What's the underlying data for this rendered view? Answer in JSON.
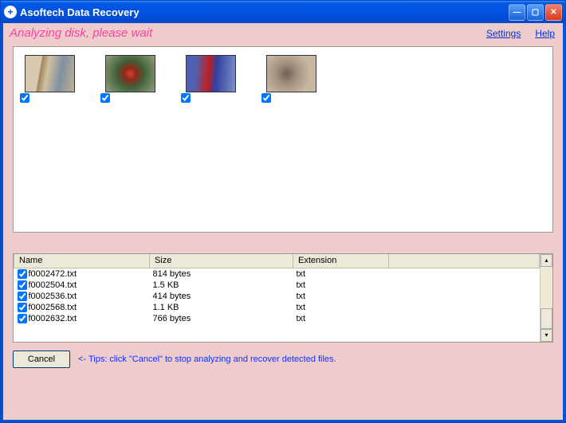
{
  "title": "Asoftech Data Recovery",
  "status": "Analyzing disk, please wait",
  "links": {
    "settings": "Settings",
    "help": "Help"
  },
  "thumbs": [
    {
      "checked": true
    },
    {
      "checked": true
    },
    {
      "checked": true
    },
    {
      "checked": true
    }
  ],
  "columns": {
    "name": "Name",
    "size": "Size",
    "ext": "Extension"
  },
  "files": [
    {
      "checked": true,
      "name": "f0002472.txt",
      "size": "814 bytes",
      "ext": "txt"
    },
    {
      "checked": true,
      "name": "f0002504.txt",
      "size": "1.5 KB",
      "ext": "txt"
    },
    {
      "checked": true,
      "name": "f0002536.txt",
      "size": "414 bytes",
      "ext": "txt"
    },
    {
      "checked": true,
      "name": "f0002568.txt",
      "size": "1.1 KB",
      "ext": "txt"
    },
    {
      "checked": true,
      "name": "f0002632.txt",
      "size": "766 bytes",
      "ext": "txt"
    }
  ],
  "footer": {
    "cancel": "Cancel",
    "tips": "<- Tips: click \"Cancel\" to stop analyzing and recover detected files."
  }
}
